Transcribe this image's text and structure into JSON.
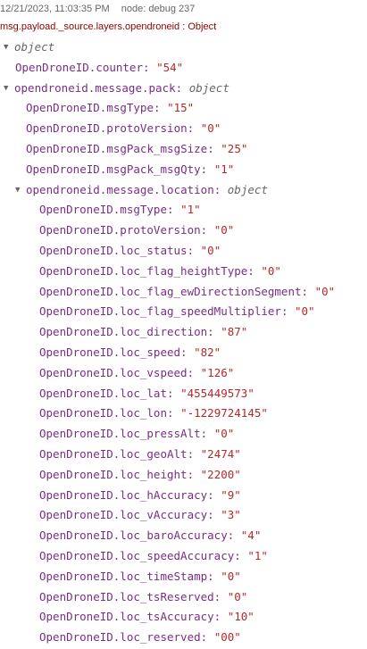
{
  "header": {
    "timestamp": "12/21/2023, 11:03:35 PM",
    "node": "node: debug 237",
    "topic": "msg.payload._source.layers.opendroneid : Object"
  },
  "tree": {
    "root": {
      "type": "object"
    },
    "counter": {
      "key": "OpenDroneID.counter",
      "value": "\"54\""
    },
    "pack": {
      "key": "opendroneid.message.pack",
      "type": "object",
      "fields": [
        {
          "key": "OpenDroneID.msgType",
          "value": "\"15\""
        },
        {
          "key": "OpenDroneID.protoVersion",
          "value": "\"0\""
        },
        {
          "key": "OpenDroneID.msgPack_msgSize",
          "value": "\"25\""
        },
        {
          "key": "OpenDroneID.msgPack_msgQty",
          "value": "\"1\""
        }
      ]
    },
    "location": {
      "key": "opendroneid.message.location",
      "type": "object",
      "fields": [
        {
          "key": "OpenDroneID.msgType",
          "value": "\"1\""
        },
        {
          "key": "OpenDroneID.protoVersion",
          "value": "\"0\""
        },
        {
          "key": "OpenDroneID.loc_status",
          "value": "\"0\""
        },
        {
          "key": "OpenDroneID.loc_flag_heightType",
          "value": "\"0\""
        },
        {
          "key": "OpenDroneID.loc_flag_ewDirectionSegment",
          "value": "\"0\""
        },
        {
          "key": "OpenDroneID.loc_flag_speedMultiplier",
          "value": "\"0\""
        },
        {
          "key": "OpenDroneID.loc_direction",
          "value": "\"87\""
        },
        {
          "key": "OpenDroneID.loc_speed",
          "value": "\"82\""
        },
        {
          "key": "OpenDroneID.loc_vspeed",
          "value": "\"126\""
        },
        {
          "key": "OpenDroneID.loc_lat",
          "value": "\"455449573\""
        },
        {
          "key": "OpenDroneID.loc_lon",
          "value": "\"-1229724145\""
        },
        {
          "key": "OpenDroneID.loc_pressAlt",
          "value": "\"0\""
        },
        {
          "key": "OpenDroneID.loc_geoAlt",
          "value": "\"2474\""
        },
        {
          "key": "OpenDroneID.loc_height",
          "value": "\"2200\""
        },
        {
          "key": "OpenDroneID.loc_hAccuracy",
          "value": "\"9\""
        },
        {
          "key": "OpenDroneID.loc_vAccuracy",
          "value": "\"3\""
        },
        {
          "key": "OpenDroneID.loc_baroAccuracy",
          "value": "\"4\""
        },
        {
          "key": "OpenDroneID.loc_speedAccuracy",
          "value": "\"1\""
        },
        {
          "key": "OpenDroneID.loc_timeStamp",
          "value": "\"0\""
        },
        {
          "key": "OpenDroneID.loc_tsReserved",
          "value": "\"0\""
        },
        {
          "key": "OpenDroneID.loc_tsAccuracy",
          "value": "\"10\""
        },
        {
          "key": "OpenDroneID.loc_reserved",
          "value": "\"00\""
        }
      ]
    }
  }
}
